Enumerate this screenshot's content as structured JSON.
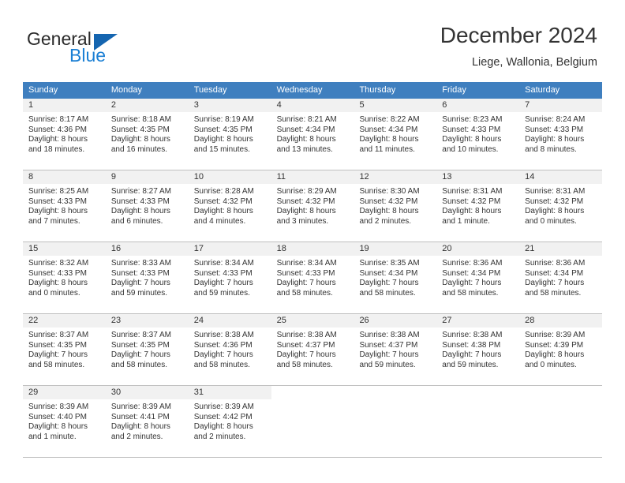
{
  "logo": {
    "line1": "General",
    "line2": "Blue",
    "triangle_color": "#1565b0"
  },
  "header": {
    "title": "December 2024",
    "subtitle": "Liege, Wallonia, Belgium"
  },
  "colors": {
    "header_band": "#3f7fbf",
    "daynum_band": "#f1f1f1",
    "grid_line": "#bfbfbf",
    "accent_blue": "#1a7fd4"
  },
  "weekdays": [
    "Sunday",
    "Monday",
    "Tuesday",
    "Wednesday",
    "Thursday",
    "Friday",
    "Saturday"
  ],
  "weeks": [
    [
      {
        "day": "1",
        "sunrise": "Sunrise: 8:17 AM",
        "sunset": "Sunset: 4:36 PM",
        "daylight1": "Daylight: 8 hours",
        "daylight2": "and 18 minutes."
      },
      {
        "day": "2",
        "sunrise": "Sunrise: 8:18 AM",
        "sunset": "Sunset: 4:35 PM",
        "daylight1": "Daylight: 8 hours",
        "daylight2": "and 16 minutes."
      },
      {
        "day": "3",
        "sunrise": "Sunrise: 8:19 AM",
        "sunset": "Sunset: 4:35 PM",
        "daylight1": "Daylight: 8 hours",
        "daylight2": "and 15 minutes."
      },
      {
        "day": "4",
        "sunrise": "Sunrise: 8:21 AM",
        "sunset": "Sunset: 4:34 PM",
        "daylight1": "Daylight: 8 hours",
        "daylight2": "and 13 minutes."
      },
      {
        "day": "5",
        "sunrise": "Sunrise: 8:22 AM",
        "sunset": "Sunset: 4:34 PM",
        "daylight1": "Daylight: 8 hours",
        "daylight2": "and 11 minutes."
      },
      {
        "day": "6",
        "sunrise": "Sunrise: 8:23 AM",
        "sunset": "Sunset: 4:33 PM",
        "daylight1": "Daylight: 8 hours",
        "daylight2": "and 10 minutes."
      },
      {
        "day": "7",
        "sunrise": "Sunrise: 8:24 AM",
        "sunset": "Sunset: 4:33 PM",
        "daylight1": "Daylight: 8 hours",
        "daylight2": "and 8 minutes."
      }
    ],
    [
      {
        "day": "8",
        "sunrise": "Sunrise: 8:25 AM",
        "sunset": "Sunset: 4:33 PM",
        "daylight1": "Daylight: 8 hours",
        "daylight2": "and 7 minutes."
      },
      {
        "day": "9",
        "sunrise": "Sunrise: 8:27 AM",
        "sunset": "Sunset: 4:33 PM",
        "daylight1": "Daylight: 8 hours",
        "daylight2": "and 6 minutes."
      },
      {
        "day": "10",
        "sunrise": "Sunrise: 8:28 AM",
        "sunset": "Sunset: 4:32 PM",
        "daylight1": "Daylight: 8 hours",
        "daylight2": "and 4 minutes."
      },
      {
        "day": "11",
        "sunrise": "Sunrise: 8:29 AM",
        "sunset": "Sunset: 4:32 PM",
        "daylight1": "Daylight: 8 hours",
        "daylight2": "and 3 minutes."
      },
      {
        "day": "12",
        "sunrise": "Sunrise: 8:30 AM",
        "sunset": "Sunset: 4:32 PM",
        "daylight1": "Daylight: 8 hours",
        "daylight2": "and 2 minutes."
      },
      {
        "day": "13",
        "sunrise": "Sunrise: 8:31 AM",
        "sunset": "Sunset: 4:32 PM",
        "daylight1": "Daylight: 8 hours",
        "daylight2": "and 1 minute."
      },
      {
        "day": "14",
        "sunrise": "Sunrise: 8:31 AM",
        "sunset": "Sunset: 4:32 PM",
        "daylight1": "Daylight: 8 hours",
        "daylight2": "and 0 minutes."
      }
    ],
    [
      {
        "day": "15",
        "sunrise": "Sunrise: 8:32 AM",
        "sunset": "Sunset: 4:33 PM",
        "daylight1": "Daylight: 8 hours",
        "daylight2": "and 0 minutes."
      },
      {
        "day": "16",
        "sunrise": "Sunrise: 8:33 AM",
        "sunset": "Sunset: 4:33 PM",
        "daylight1": "Daylight: 7 hours",
        "daylight2": "and 59 minutes."
      },
      {
        "day": "17",
        "sunrise": "Sunrise: 8:34 AM",
        "sunset": "Sunset: 4:33 PM",
        "daylight1": "Daylight: 7 hours",
        "daylight2": "and 59 minutes."
      },
      {
        "day": "18",
        "sunrise": "Sunrise: 8:34 AM",
        "sunset": "Sunset: 4:33 PM",
        "daylight1": "Daylight: 7 hours",
        "daylight2": "and 58 minutes."
      },
      {
        "day": "19",
        "sunrise": "Sunrise: 8:35 AM",
        "sunset": "Sunset: 4:34 PM",
        "daylight1": "Daylight: 7 hours",
        "daylight2": "and 58 minutes."
      },
      {
        "day": "20",
        "sunrise": "Sunrise: 8:36 AM",
        "sunset": "Sunset: 4:34 PM",
        "daylight1": "Daylight: 7 hours",
        "daylight2": "and 58 minutes."
      },
      {
        "day": "21",
        "sunrise": "Sunrise: 8:36 AM",
        "sunset": "Sunset: 4:34 PM",
        "daylight1": "Daylight: 7 hours",
        "daylight2": "and 58 minutes."
      }
    ],
    [
      {
        "day": "22",
        "sunrise": "Sunrise: 8:37 AM",
        "sunset": "Sunset: 4:35 PM",
        "daylight1": "Daylight: 7 hours",
        "daylight2": "and 58 minutes."
      },
      {
        "day": "23",
        "sunrise": "Sunrise: 8:37 AM",
        "sunset": "Sunset: 4:35 PM",
        "daylight1": "Daylight: 7 hours",
        "daylight2": "and 58 minutes."
      },
      {
        "day": "24",
        "sunrise": "Sunrise: 8:38 AM",
        "sunset": "Sunset: 4:36 PM",
        "daylight1": "Daylight: 7 hours",
        "daylight2": "and 58 minutes."
      },
      {
        "day": "25",
        "sunrise": "Sunrise: 8:38 AM",
        "sunset": "Sunset: 4:37 PM",
        "daylight1": "Daylight: 7 hours",
        "daylight2": "and 58 minutes."
      },
      {
        "day": "26",
        "sunrise": "Sunrise: 8:38 AM",
        "sunset": "Sunset: 4:37 PM",
        "daylight1": "Daylight: 7 hours",
        "daylight2": "and 59 minutes."
      },
      {
        "day": "27",
        "sunrise": "Sunrise: 8:38 AM",
        "sunset": "Sunset: 4:38 PM",
        "daylight1": "Daylight: 7 hours",
        "daylight2": "and 59 minutes."
      },
      {
        "day": "28",
        "sunrise": "Sunrise: 8:39 AM",
        "sunset": "Sunset: 4:39 PM",
        "daylight1": "Daylight: 8 hours",
        "daylight2": "and 0 minutes."
      }
    ],
    [
      {
        "day": "29",
        "sunrise": "Sunrise: 8:39 AM",
        "sunset": "Sunset: 4:40 PM",
        "daylight1": "Daylight: 8 hours",
        "daylight2": "and 1 minute."
      },
      {
        "day": "30",
        "sunrise": "Sunrise: 8:39 AM",
        "sunset": "Sunset: 4:41 PM",
        "daylight1": "Daylight: 8 hours",
        "daylight2": "and 2 minutes."
      },
      {
        "day": "31",
        "sunrise": "Sunrise: 8:39 AM",
        "sunset": "Sunset: 4:42 PM",
        "daylight1": "Daylight: 8 hours",
        "daylight2": "and 2 minutes."
      },
      {
        "day": "",
        "sunrise": "",
        "sunset": "",
        "daylight1": "",
        "daylight2": ""
      },
      {
        "day": "",
        "sunrise": "",
        "sunset": "",
        "daylight1": "",
        "daylight2": ""
      },
      {
        "day": "",
        "sunrise": "",
        "sunset": "",
        "daylight1": "",
        "daylight2": ""
      },
      {
        "day": "",
        "sunrise": "",
        "sunset": "",
        "daylight1": "",
        "daylight2": ""
      }
    ]
  ]
}
